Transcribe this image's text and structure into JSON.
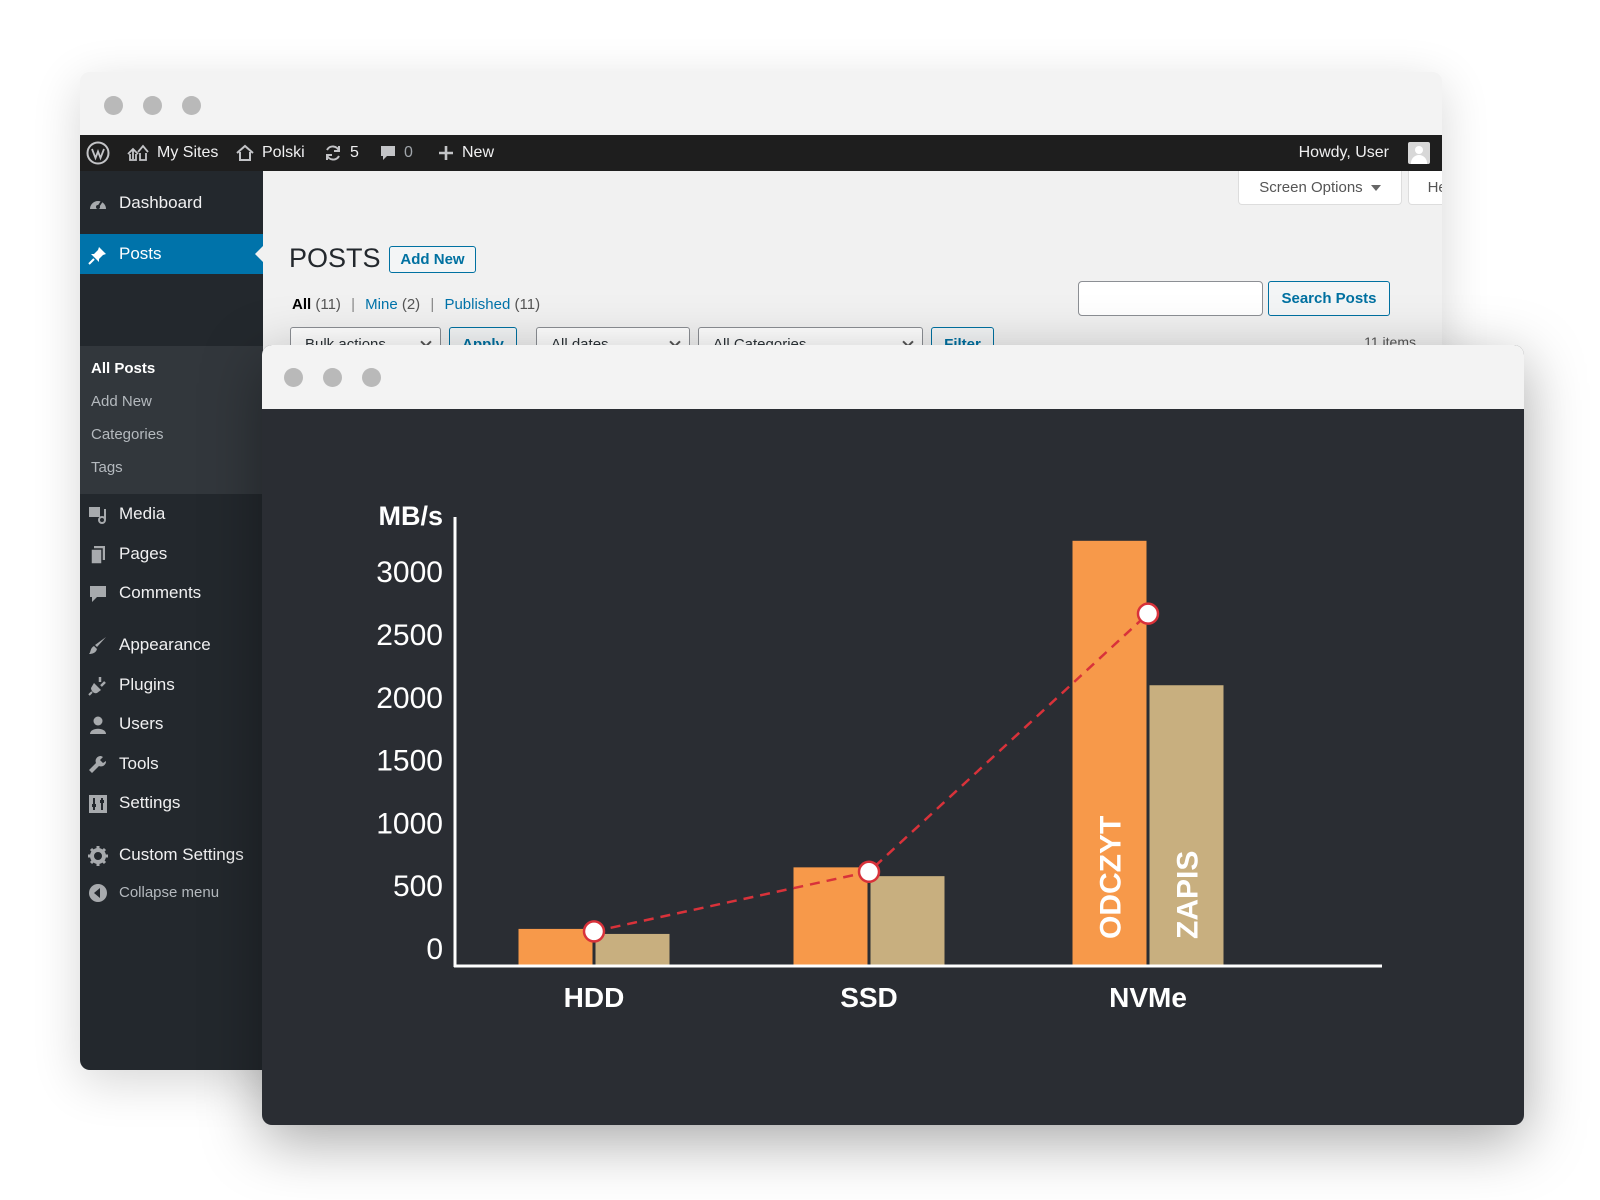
{
  "admin_bar": {
    "my_sites": "My Sites",
    "site_name": "Polski",
    "updates_count": "5",
    "comments_count": "0",
    "new_label": "New",
    "greeting": "Howdy, User"
  },
  "sidebar": {
    "items": [
      {
        "label": "Dashboard",
        "icon": "dashboard-icon"
      },
      {
        "label": "Posts",
        "icon": "pin-icon"
      },
      {
        "label": "Media",
        "icon": "media-icon"
      },
      {
        "label": "Pages",
        "icon": "pages-icon"
      },
      {
        "label": "Comments",
        "icon": "comment-icon"
      },
      {
        "label": "Appearance",
        "icon": "brush-icon"
      },
      {
        "label": "Plugins",
        "icon": "plugin-icon"
      },
      {
        "label": "Users",
        "icon": "user-icon"
      },
      {
        "label": "Tools",
        "icon": "wrench-icon"
      },
      {
        "label": "Settings",
        "icon": "sliders-icon"
      },
      {
        "label": "Custom Settings",
        "icon": "gear-icon"
      }
    ],
    "posts_submenu": [
      "All Posts",
      "Add New",
      "Categories",
      "Tags"
    ],
    "collapse": "Collapse menu"
  },
  "content": {
    "screen_options": "Screen Options",
    "help": "Help",
    "page_title": "POSTS",
    "add_new": "Add New",
    "filters": {
      "all": "All",
      "all_count": "(11)",
      "mine": "Mine",
      "mine_count": "(2)",
      "published": "Published",
      "published_count": "(11)"
    },
    "search_button": "Search Posts",
    "search_value": "",
    "bulk_actions": "Bulk actions",
    "apply": "Apply",
    "all_dates": "All dates",
    "all_categories": "All Categories",
    "filter": "Filter",
    "items_count": "11 items"
  },
  "colors": {
    "read_bar": "#f7994a",
    "write_bar": "#c8af7f",
    "trend_line": "#d8323a",
    "chart_bg": "#2a2d33",
    "accent": "#0073aa"
  },
  "chart_data": {
    "type": "bar",
    "ylabel": "MB/s",
    "xlabel": "",
    "title": "",
    "ylim": [
      0,
      3000
    ],
    "yticks": [
      0,
      500,
      1000,
      1500,
      2000,
      2500,
      3000
    ],
    "categories": [
      "HDD",
      "SSD",
      "NVMe"
    ],
    "series": [
      {
        "name": "ODCZYT",
        "values": [
          160,
          650,
          3250
        ]
      },
      {
        "name": "ZAPIS",
        "values": [
          120,
          580,
          2100
        ]
      }
    ],
    "trend_line": {
      "values": [
        140,
        615,
        2670
      ]
    },
    "grid": false,
    "legend": "inside-bars"
  }
}
